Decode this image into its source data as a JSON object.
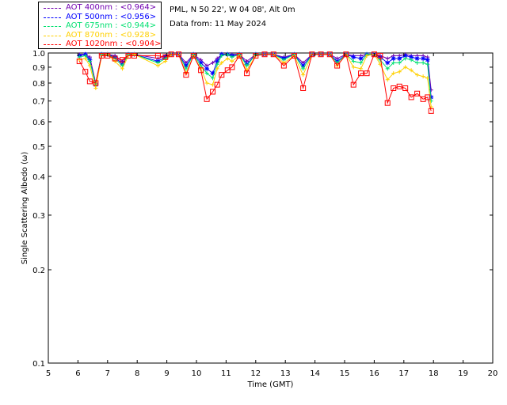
{
  "header": {
    "location": "PML, N 50 22', W 04 08', Alt 0m",
    "date": "Data from: 11 May 2024"
  },
  "chart_data": {
    "type": "scatter",
    "title": "",
    "xlabel": "Time (GMT)",
    "ylabel": "Single Scattering Albedo (ω)",
    "xlim": [
      5,
      20
    ],
    "ylim": [
      0.1,
      1.0
    ],
    "yscale": "log",
    "grid": false,
    "legend_position": "top-left",
    "xticks": [
      5,
      6,
      7,
      8,
      9,
      10,
      11,
      12,
      13,
      14,
      15,
      16,
      17,
      18,
      19,
      20
    ],
    "yticks": [
      {
        "value": 0.1,
        "label": "0.1"
      },
      {
        "value": 0.2,
        "label": "0.2"
      },
      {
        "value": 0.3,
        "label": "0.3"
      },
      {
        "value": 0.4,
        "label": "0.4"
      },
      {
        "value": 0.5,
        "label": "0.5"
      },
      {
        "value": 0.6,
        "label": "0.6"
      },
      {
        "value": 0.7,
        "label": "0.7"
      },
      {
        "value": 0.8,
        "label": "0.8"
      },
      {
        "value": 0.9,
        "label": "0.9"
      },
      {
        "value": 1.0,
        "label": "1.0"
      }
    ],
    "x": [
      6.05,
      6.25,
      6.4,
      6.6,
      6.8,
      7.0,
      7.25,
      7.5,
      7.7,
      7.9,
      8.7,
      8.95,
      9.15,
      9.4,
      9.65,
      9.9,
      10.15,
      10.35,
      10.55,
      10.7,
      10.85,
      11.05,
      11.2,
      11.45,
      11.7,
      12.0,
      12.3,
      12.6,
      12.95,
      13.3,
      13.6,
      13.9,
      14.2,
      14.5,
      14.75,
      15.05,
      15.3,
      15.55,
      15.75,
      16.0,
      16.2,
      16.45,
      16.65,
      16.85,
      17.05,
      17.25,
      17.45,
      17.65,
      17.8,
      17.92
    ],
    "series": [
      {
        "name": "AOT  400nm : <0.964>",
        "color": "#7000b0",
        "marker": "plus",
        "values": [
          0.99,
          0.99,
          0.97,
          0.8,
          0.99,
          0.99,
          0.98,
          0.94,
          0.99,
          0.99,
          0.96,
          0.98,
          0.99,
          0.99,
          0.93,
          0.99,
          0.95,
          0.91,
          0.93,
          0.96,
          0.99,
          0.99,
          0.99,
          0.99,
          0.94,
          0.99,
          0.99,
          0.99,
          0.97,
          0.99,
          0.93,
          0.99,
          0.99,
          0.99,
          0.96,
          0.99,
          0.98,
          0.98,
          0.99,
          0.99,
          0.98,
          0.96,
          0.98,
          0.98,
          0.99,
          0.98,
          0.98,
          0.98,
          0.97,
          0.76
        ]
      },
      {
        "name": "AOT  500nm : <0.956>",
        "color": "#0000ff",
        "marker": "star",
        "values": [
          0.98,
          0.99,
          0.95,
          0.79,
          0.99,
          0.99,
          0.97,
          0.92,
          0.99,
          0.99,
          0.94,
          0.97,
          0.99,
          0.99,
          0.91,
          0.99,
          0.93,
          0.89,
          0.86,
          0.94,
          0.99,
          0.99,
          0.98,
          0.99,
          0.92,
          0.99,
          0.99,
          0.99,
          0.96,
          0.99,
          0.91,
          0.99,
          0.99,
          0.99,
          0.94,
          0.99,
          0.97,
          0.96,
          0.99,
          0.99,
          0.97,
          0.93,
          0.96,
          0.96,
          0.98,
          0.97,
          0.96,
          0.96,
          0.95,
          0.72
        ]
      },
      {
        "name": "AOT  675nm : <0.944>",
        "color": "#00e070",
        "marker": "plus",
        "values": [
          0.97,
          0.98,
          0.94,
          0.79,
          0.99,
          0.99,
          0.96,
          0.91,
          0.99,
          0.99,
          0.93,
          0.96,
          0.99,
          0.99,
          0.89,
          0.99,
          0.91,
          0.86,
          0.83,
          0.92,
          0.98,
          0.99,
          0.97,
          0.99,
          0.91,
          0.99,
          0.99,
          0.99,
          0.95,
          0.99,
          0.89,
          0.99,
          0.99,
          0.99,
          0.93,
          0.99,
          0.94,
          0.93,
          0.99,
          0.99,
          0.95,
          0.89,
          0.93,
          0.93,
          0.96,
          0.95,
          0.93,
          0.93,
          0.92,
          0.7
        ]
      },
      {
        "name": "AOT  870nm : <0.928>",
        "color": "#ffd000",
        "marker": "plus",
        "values": [
          0.95,
          0.96,
          0.91,
          0.77,
          0.98,
          0.99,
          0.94,
          0.89,
          0.98,
          0.99,
          0.91,
          0.94,
          0.99,
          0.99,
          0.86,
          0.98,
          0.89,
          0.8,
          0.79,
          0.89,
          0.93,
          0.96,
          0.94,
          0.98,
          0.88,
          0.98,
          0.99,
          0.99,
          0.93,
          0.98,
          0.85,
          0.99,
          0.99,
          0.99,
          0.91,
          0.99,
          0.9,
          0.89,
          0.98,
          0.99,
          0.92,
          0.82,
          0.86,
          0.87,
          0.9,
          0.88,
          0.85,
          0.84,
          0.83,
          0.67
        ]
      },
      {
        "name": "AOT 1020nm : <0.904>",
        "color": "#ff0000",
        "marker": "square",
        "values": [
          0.94,
          0.87,
          0.81,
          0.8,
          0.98,
          0.98,
          0.96,
          0.95,
          0.98,
          0.98,
          0.98,
          0.97,
          0.99,
          0.99,
          0.85,
          0.98,
          0.88,
          0.71,
          0.75,
          0.79,
          0.85,
          0.88,
          0.9,
          0.98,
          0.86,
          0.98,
          0.99,
          0.99,
          0.91,
          0.98,
          0.77,
          0.99,
          0.99,
          0.99,
          0.91,
          0.99,
          0.79,
          0.86,
          0.86,
          0.99,
          0.98,
          0.69,
          0.77,
          0.78,
          0.77,
          0.72,
          0.74,
          0.71,
          0.72,
          0.65
        ]
      }
    ]
  }
}
